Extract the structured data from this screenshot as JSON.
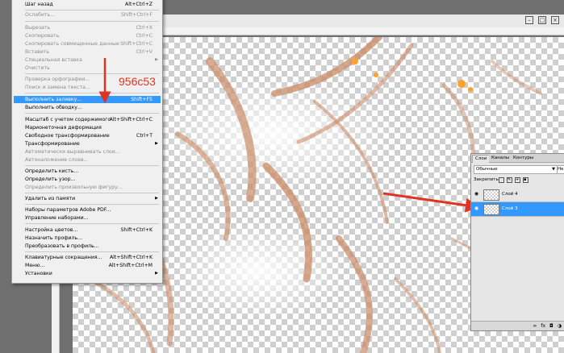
{
  "menu": {
    "items": [
      {
        "label": "Шаг назад",
        "shortcut": "Alt+Ctrl+Z",
        "disabled": false
      },
      {
        "label": "Ослабить...",
        "shortcut": "Shift+Ctrl+F",
        "disabled": true
      },
      {
        "label": "Вырезать",
        "shortcut": "Ctrl+X",
        "disabled": true
      },
      {
        "label": "Скопировать",
        "shortcut": "Ctrl+C",
        "disabled": true
      },
      {
        "label": "Скопировать совмещенные данные",
        "shortcut": "Shift+Ctrl+C",
        "disabled": true
      },
      {
        "label": "Вставить",
        "shortcut": "Ctrl+V",
        "disabled": true
      },
      {
        "label": "Специальная вставка",
        "shortcut": "",
        "disabled": true
      },
      {
        "label": "Очистить",
        "shortcut": "",
        "disabled": true
      },
      {
        "label": "Проверка орфографии...",
        "shortcut": "",
        "disabled": true
      },
      {
        "label": "Поиск и замена текста...",
        "shortcut": "",
        "disabled": true
      },
      {
        "label": "Выполнить заливку...",
        "shortcut": "Shift+F5",
        "disabled": false,
        "highlighted": true
      },
      {
        "label": "Выполнить обводку...",
        "shortcut": "",
        "disabled": false
      },
      {
        "label": "Масштаб с учетом содержимого",
        "shortcut": "Alt+Shift+Ctrl+C",
        "disabled": false
      },
      {
        "label": "Марионеточная деформация",
        "shortcut": "",
        "disabled": false
      },
      {
        "label": "Свободное трансформирование",
        "shortcut": "Ctrl+T",
        "disabled": false
      },
      {
        "label": "Трансформирование",
        "shortcut": "",
        "disabled": false
      },
      {
        "label": "Автоматически выравнивать слои...",
        "shortcut": "",
        "disabled": true
      },
      {
        "label": "Автоналожение слоев...",
        "shortcut": "",
        "disabled": true
      },
      {
        "label": "Определить кисть...",
        "shortcut": "",
        "disabled": false
      },
      {
        "label": "Определить узор...",
        "shortcut": "",
        "disabled": false
      },
      {
        "label": "Определить произвольную фигуру...",
        "shortcut": "",
        "disabled": true
      },
      {
        "label": "Удалить из памяти",
        "shortcut": "",
        "disabled": false
      },
      {
        "label": "Наборы параметров Adobe PDF...",
        "shortcut": "",
        "disabled": false
      },
      {
        "label": "Управление наборами...",
        "shortcut": "",
        "disabled": false
      },
      {
        "label": "Настройка цветов...",
        "shortcut": "Shift+Ctrl+K",
        "disabled": false
      },
      {
        "label": "Назначить профиль...",
        "shortcut": "",
        "disabled": false
      },
      {
        "label": "Преобразовать в профиль...",
        "shortcut": "",
        "disabled": false
      },
      {
        "label": "Клавиатурные сокращения...",
        "shortcut": "Alt+Shift+Ctrl+K",
        "disabled": false
      },
      {
        "label": "Меню...",
        "shortcut": "Alt+Shift+Ctrl+M",
        "disabled": false
      },
      {
        "label": "Установки",
        "shortcut": "",
        "disabled": false
      }
    ]
  },
  "annotation": {
    "text": "956c53",
    "color": "#e03420"
  },
  "layers_panel": {
    "tabs": [
      "Слои",
      "Каналы",
      "Контуры"
    ],
    "blend_mode": "Обычные",
    "opacity_label": "Непр",
    "lock_label": "Закрепить:",
    "layers": [
      {
        "name": "Слой 4",
        "selected": false
      },
      {
        "name": "Слой 3",
        "selected": true
      }
    ],
    "footer_icons": [
      "link-icon",
      "fx-icon"
    ]
  },
  "colors": {
    "highlight": "#3399ff",
    "accent": "#e03420"
  }
}
